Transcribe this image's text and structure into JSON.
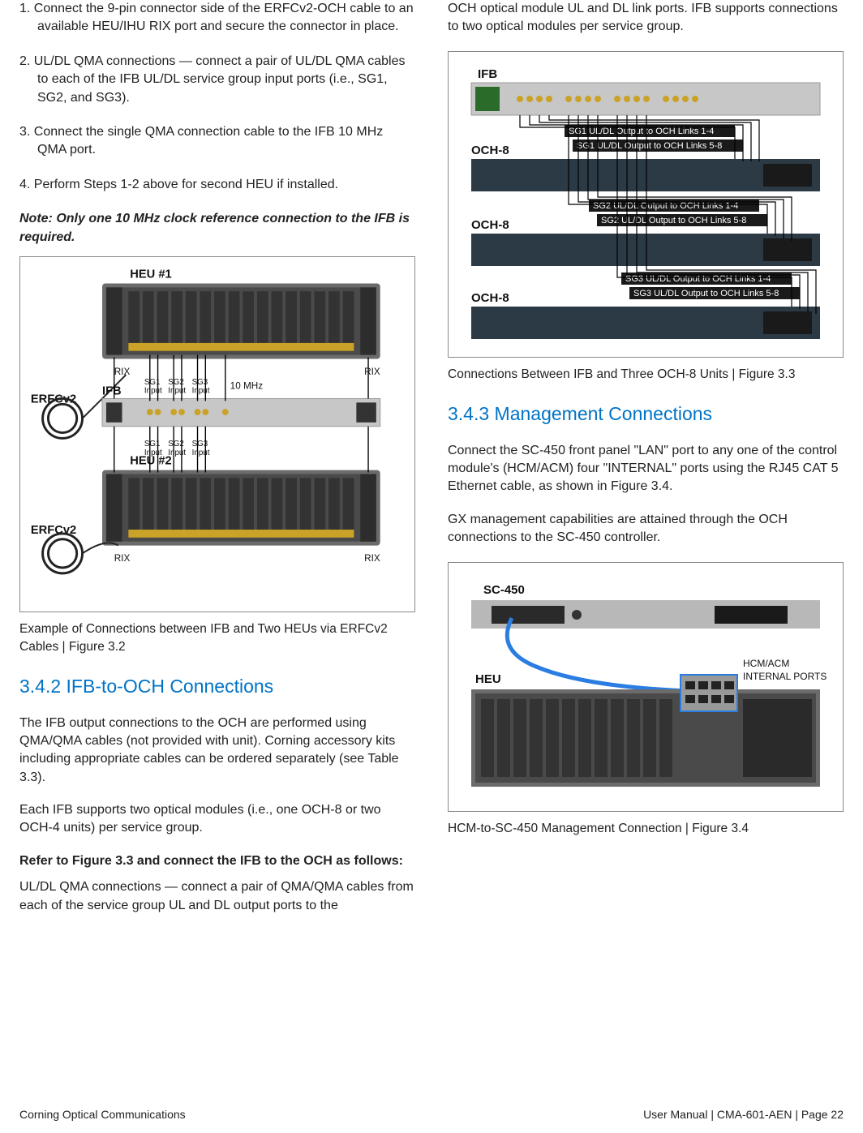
{
  "left": {
    "steps": [
      "1.  Connect the 9-pin connector side of the ERFCv2-OCH cable to an available HEU/IHU RIX port and secure the connector in place.",
      "2.  UL/DL QMA connections — connect a pair of UL/DL QMA cables to each of the IFB UL/DL service group input ports (i.e., SG1, SG2, and SG3).",
      "3.  Connect the single QMA connection cable to the IFB 10 MHz QMA port.",
      "4.  Perform Steps 1-2 above for second HEU if installed."
    ],
    "note": "Note:  Only one 10 MHz clock reference connection to the IFB is required.",
    "fig32_caption": "Example of Connections between IFB and Two HEUs  via ERFCv2 Cables | Figure 3.2",
    "h342": "3.4.2  IFB-to-OCH Connections",
    "p342a": "The IFB output connections to the OCH are performed using QMA/QMA cables (not provided with unit). Corning accessory kits including appropriate cables can be ordered separately (see Table 3.3).",
    "p342b": "Each IFB supports two optical modules (i.e., one OCH-8 or two OCH-4 units) per service group.",
    "boldline": "Refer to Figure 3.3 and connect the IFB to the OCH as follows:",
    "p342c": "UL/DL QMA connections — connect a pair of QMA/QMA cables from each of the service group UL and DL output ports to the"
  },
  "right": {
    "p_top": "OCH optical module UL and DL link ports. IFB supports connections to two optical modules per service group.",
    "fig33_caption": "Connections Between IFB and Three OCH-8 Units | Figure 3.3",
    "h343": "3.4.3  Management Connections",
    "p343a": "Connect the SC-450 front panel \"LAN\" port to any one of the control module's (HCM/ACM) four \"INTERNAL\" ports using the RJ45 CAT 5 Ethernet cable, as shown in Figure 3.4.",
    "p343b": "GX management capabilities are attained through the OCH connections to the SC-450 controller.",
    "fig34_caption": "HCM-to-SC-450 Management Connection | Figure 3.4"
  },
  "fig32": {
    "heu1": "HEU #1",
    "heu2": "HEU #2",
    "ifb": "IFB",
    "erfcv2": "ERFCv2",
    "rix": "RIX",
    "sg1": "SG1\nInput",
    "sg2": "SG2\nInput",
    "sg3": "SG3\nInput",
    "tenmhz": "10 MHz"
  },
  "fig33": {
    "ifb": "IFB",
    "och8": "OCH-8",
    "lbl1a": "SG1 UL/DL Output to OCH Links 1-4",
    "lbl1b": "SG1 UL/DL Output to OCH Links 5-8",
    "lbl2a": "SG2 UL/DL Output to OCH Links 1-4",
    "lbl2b": "SG2 UL/DL Output to OCH Links 5-8",
    "lbl3a": "SG3 UL/DL Output to OCH Links 1-4",
    "lbl3b": "SG3 UL/DL Output to OCH Links 5-8"
  },
  "fig34": {
    "sc450": "SC-450",
    "heu": "HEU",
    "hcm": "HCM/ACM\nINTERNAL PORTS"
  },
  "footer": {
    "left": "Corning Optical Communications",
    "right": "User Manual | CMA-601-AEN | Page 22"
  }
}
